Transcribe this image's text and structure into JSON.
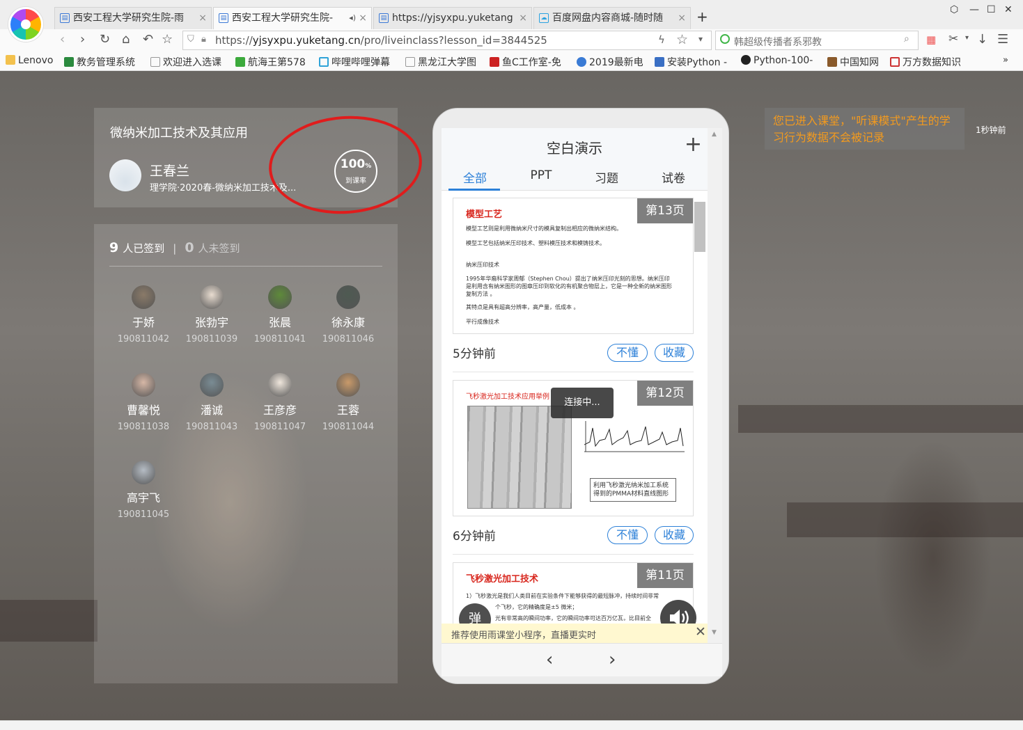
{
  "browser": {
    "tabs": [
      {
        "label": "西安工程大学研究生院-雨",
        "active": false
      },
      {
        "label": "西安工程大学研究生院-",
        "active": true
      },
      {
        "label": "https://yjsyxpu.yuketang",
        "active": false
      },
      {
        "label": "百度网盘内容商城-随时随",
        "active": false
      }
    ],
    "url_prefix": "https://",
    "url_host": "yjsyxpu.yuketang.cn",
    "url_path": "/pro/liveinclass?lesson_id=3844525",
    "search_text": "韩超级传播者系邪教",
    "bookmarks": [
      "Lenovo",
      "教务管理系统",
      "欢迎进入选课",
      "航海王第578",
      "哔哩哔哩弹幕",
      "黑龙江大学图",
      "鱼C工作室-免",
      "2019最新电",
      "安装Python -",
      "Python-100-",
      "中国知网",
      "万方数据知识"
    ]
  },
  "course": {
    "title": "微纳米加工技术及其应用",
    "teacher_name": "王春兰",
    "teacher_desc": "理学院·2020春-微纳米加工技术及...",
    "rate_value": "100",
    "rate_unit": "%",
    "rate_label": "到课率"
  },
  "signin": {
    "signed_count": "9",
    "signed_label": "人已签到",
    "unsigned_count": "0",
    "unsigned_label": "人未签到",
    "separator": "|",
    "students": [
      {
        "name": "于娇",
        "id": "190811042",
        "color": "#8a7a68"
      },
      {
        "name": "张勃宇",
        "id": "190811039",
        "color": "#e8dcd0"
      },
      {
        "name": "张晨",
        "id": "190811041",
        "color": "#5e8a3a"
      },
      {
        "name": "徐永康",
        "id": "190811046",
        "color": "#4e5a52"
      },
      {
        "name": "曹馨悦",
        "id": "190811038",
        "color": "#d6b7a6"
      },
      {
        "name": "潘诚",
        "id": "190811043",
        "color": "#7a8c94"
      },
      {
        "name": "王彦彦",
        "id": "190811047",
        "color": "#efe6dc"
      },
      {
        "name": "王蓉",
        "id": "190811044",
        "color": "#c99a6a"
      },
      {
        "name": "高宇飞",
        "id": "190811045",
        "color": "#b5bcc4"
      }
    ]
  },
  "presentation": {
    "title": "空白演示",
    "filter_tabs": [
      "全部",
      "PPT",
      "习题",
      "试卷"
    ],
    "slides": [
      {
        "badge": "第13页",
        "title": "模型工艺",
        "lines": [
          "模型工艺则是利用微纳米尺寸的模具复制出相应的微纳米结构。",
          "模型工艺包括纳米压印技术、塑料模压技术和模铸技术。",
          "纳米压印技术",
          "1995年华裔科学家周郁（Stephen Chou）提出了纳米压印光刻的思想。纳米压印是利用含有纳米图形的图章压印到软化的有机聚合物层上，它是一种全新的纳米图形复制方法 。",
          "其特点是具有超高分辨率，高产量，低成本 。",
          "平行成像技术"
        ],
        "time": "5分钟前"
      },
      {
        "badge": "第12页",
        "title": "飞秒激光加工技术应用举例",
        "caption": "利用飞秒激光纳米加工系统得到的PMMA材料直线图形",
        "time": "6分钟前"
      },
      {
        "badge": "第11页",
        "title": "飞秒激光加工技术",
        "lines": [
          "1）飞秒激光是我们人类目前在实验条件下能够获得的最短脉冲，持续时间非常",
          "个飞秒，它的精确度是±5 微米；",
          "光有非常高的瞬间功率，它的瞬间功率可达百万亿瓦，比目前全"
        ]
      }
    ],
    "btn_dont_understand": "不懂",
    "btn_favorite": "收藏",
    "connecting": "连接中...",
    "danmu": "弹",
    "tip": "推荐使用雨课堂小程序，直播更实时"
  },
  "notice": {
    "text": "您已进入课堂，\"听课模式\"产生的学习行为数据不会被记录",
    "time": "1秒钟前"
  },
  "colors": {
    "accent": "#2c80d8",
    "annotation": "#e01c1c",
    "notice": "#f39a1e"
  }
}
